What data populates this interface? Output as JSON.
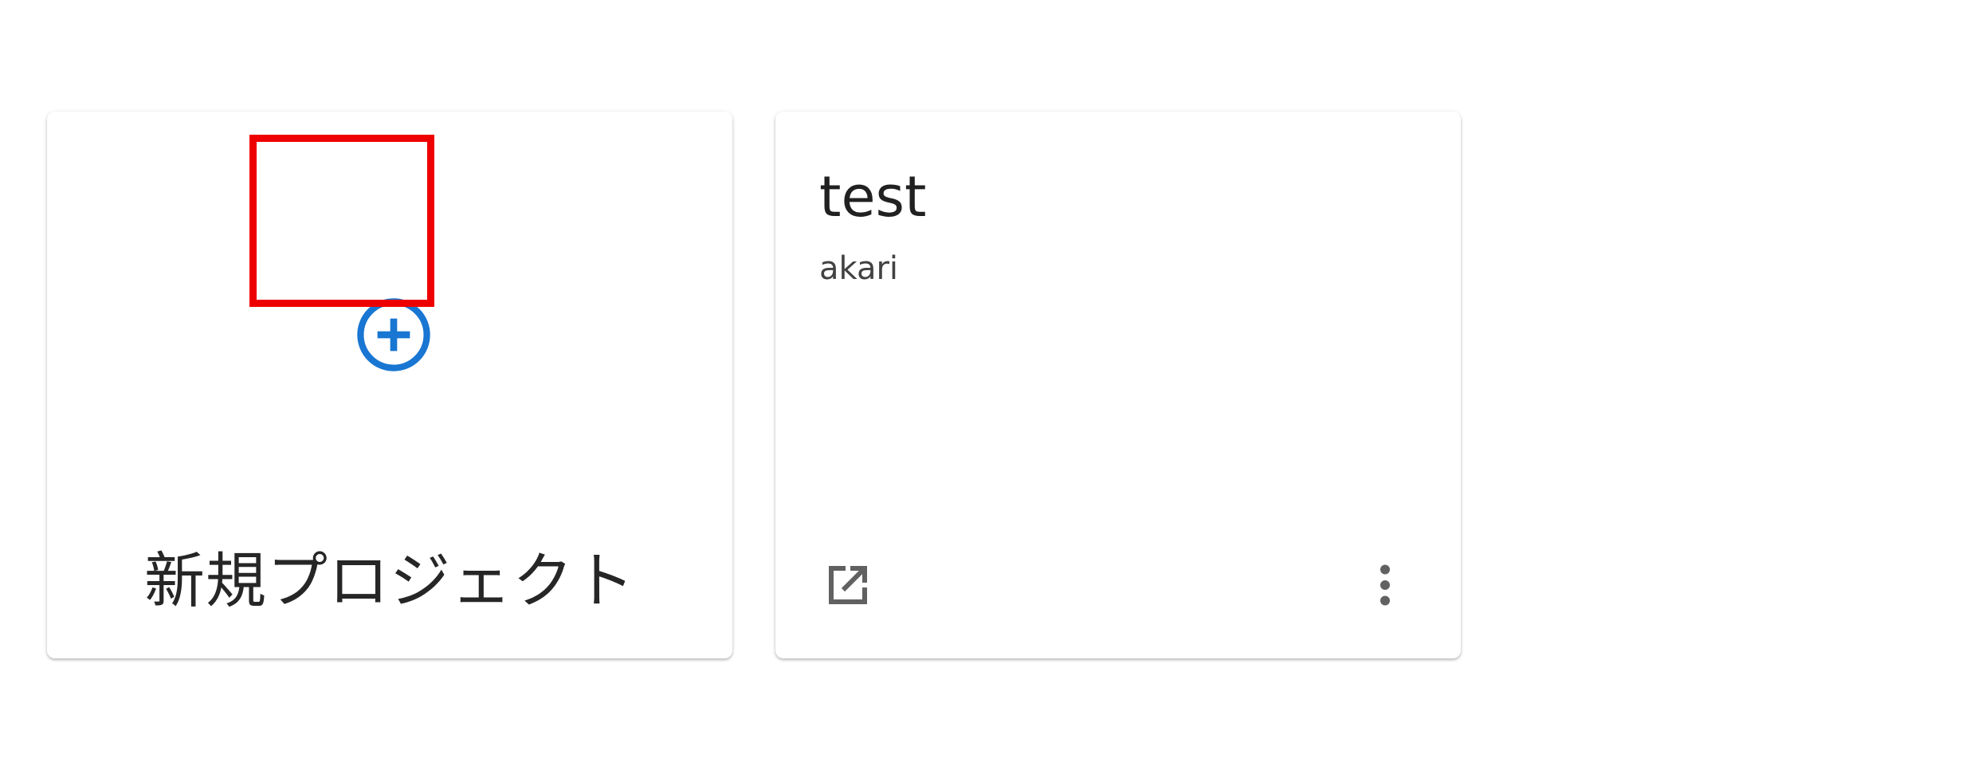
{
  "new_project_card": {
    "label": "新規プロジェクト",
    "icon": "add-circle-icon",
    "icon_color": "#1976d2",
    "highlight_color": "#ee0000"
  },
  "project_card": {
    "title": "test",
    "owner": "akari",
    "open_icon": "open-in-new-icon",
    "more_icon": "more-vert-icon",
    "icon_color": "#616161"
  }
}
